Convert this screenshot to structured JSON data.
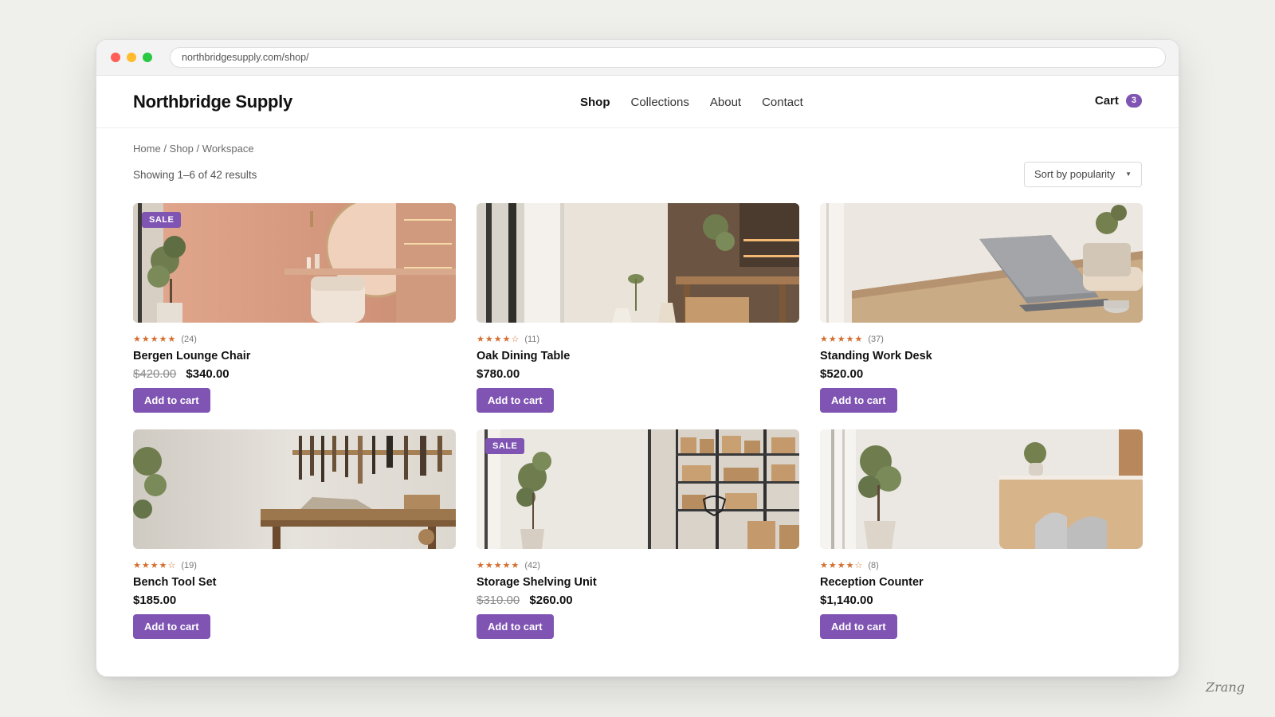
{
  "browser": {
    "url": "northbridgesupply.com/shop/"
  },
  "header": {
    "logo": "Northbridge Supply",
    "nav": [
      {
        "label": "Shop",
        "active": true
      },
      {
        "label": "Collections",
        "active": false
      },
      {
        "label": "About",
        "active": false
      },
      {
        "label": "Contact",
        "active": false
      }
    ],
    "cart_label": "Cart",
    "cart_count": "3"
  },
  "breadcrumb": [
    "Home",
    "Shop",
    "Workspace"
  ],
  "results_text": "Showing 1–6 of 42 results",
  "sort": {
    "selected": "Sort by popularity"
  },
  "colors": {
    "accent": "#7f54b3",
    "star": "#d36e2e"
  },
  "products": [
    {
      "name": "Bergen Lounge Chair",
      "stars": "★★★★★",
      "reviews": "(24)",
      "old_price": "$420.00",
      "price": "$340.00",
      "sale": true,
      "sale_label": "SALE",
      "button": "Add to cart"
    },
    {
      "name": "Oak Dining Table",
      "stars": "★★★★☆",
      "reviews": "(11)",
      "old_price": "",
      "price": "$780.00",
      "sale": false,
      "sale_label": "",
      "button": "Add to cart"
    },
    {
      "name": "Standing Work Desk",
      "stars": "★★★★★",
      "reviews": "(37)",
      "old_price": "",
      "price": "$520.00",
      "sale": false,
      "sale_label": "",
      "button": "Add to cart"
    },
    {
      "name": "Bench Tool Set",
      "stars": "★★★★☆",
      "reviews": "(19)",
      "old_price": "",
      "price": "$185.00",
      "sale": false,
      "sale_label": "",
      "button": "Add to cart"
    },
    {
      "name": "Storage Shelving Unit",
      "stars": "★★★★★",
      "reviews": "(42)",
      "old_price": "$310.00",
      "price": "$260.00",
      "sale": true,
      "sale_label": "SALE",
      "button": "Add to cart"
    },
    {
      "name": "Reception Counter",
      "stars": "★★★★☆",
      "reviews": "(8)",
      "old_price": "",
      "price": "$1,140.00",
      "sale": false,
      "sale_label": "",
      "button": "Add to cart"
    }
  ],
  "watermark": "Zrang"
}
